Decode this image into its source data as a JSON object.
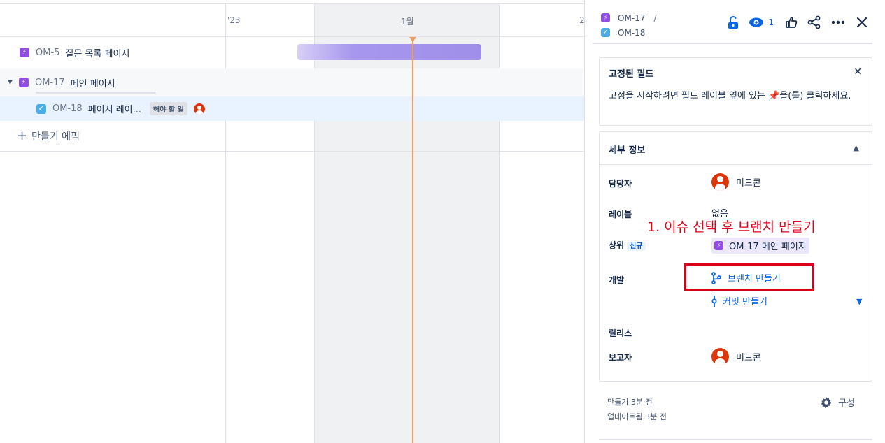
{
  "timeline": {
    "months": [
      "'23",
      "1월",
      "2"
    ]
  },
  "issues": [
    {
      "key": "OM-5",
      "summary": "질문 목록 페이지",
      "type": "epic"
    },
    {
      "key": "OM-17",
      "summary": "메인 페이지",
      "type": "epic",
      "expanded": true
    },
    {
      "key": "OM-18",
      "summary": "페이지 레이...",
      "type": "task",
      "status": "해야 할 일"
    }
  ],
  "create_epic_label": "만들기 에픽",
  "panel": {
    "breadcrumb_parent": "OM-17",
    "breadcrumb_sep": "/",
    "breadcrumb_current": "OM-18",
    "watch_count": "1",
    "pinned": {
      "title": "고정된 필드",
      "description": "고정을 시작하려면 필드 레이블 옆에 있는 📌을(를) 클릭하세요."
    },
    "details": {
      "title": "세부 정보",
      "assignee_label": "담당자",
      "assignee": "미드콘",
      "labels_label": "레이블",
      "labels_value": "없음",
      "parent_label": "상위",
      "parent_tag": "신규",
      "parent_value": "OM-17 메인 페이지",
      "dev_label": "개발",
      "create_branch": "브랜치 만들기",
      "create_commit": "커밋 만들기",
      "release_label": "릴리스",
      "reporter_label": "보고자",
      "reporter": "미드콘"
    },
    "created": "만들기 3분 전",
    "updated": "업데이트됨 3분 전",
    "configure": "구성"
  },
  "annotation": "1. 이슈 선택 후 브랜치 만들기",
  "colors": {
    "epic": "#904ee2",
    "task": "#4bade8",
    "link": "#0c66e4",
    "today": "#f79a5a",
    "annotation": "#e2001a"
  }
}
